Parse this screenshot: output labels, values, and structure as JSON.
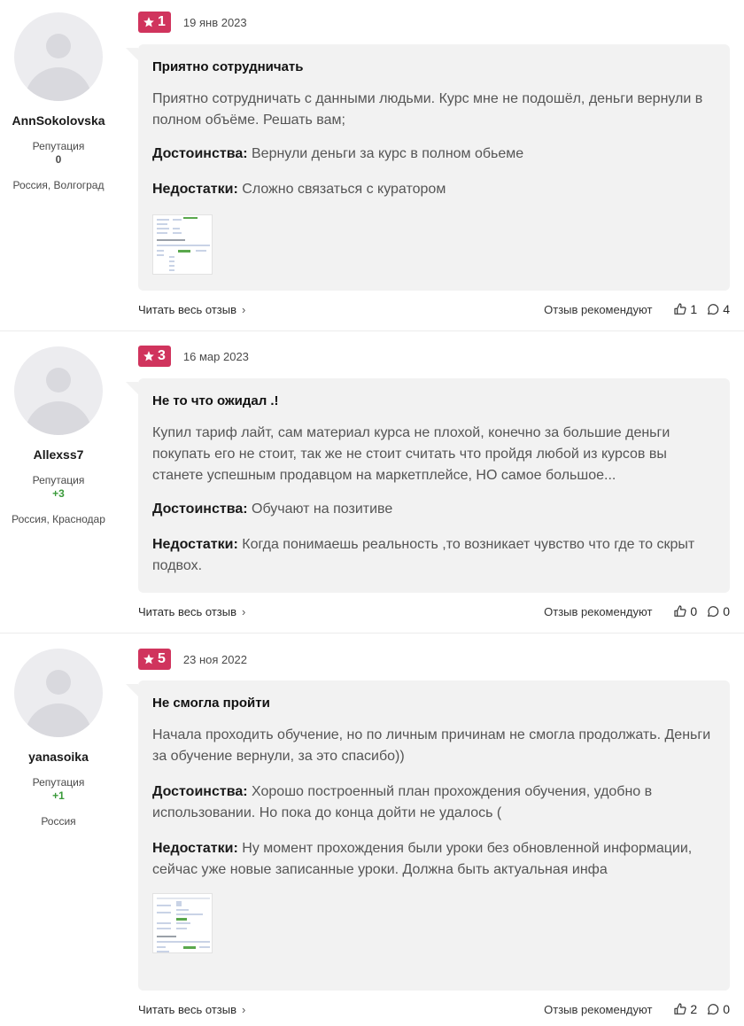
{
  "reviews": [
    {
      "rating": "1",
      "date": "19 янв 2023",
      "author": {
        "name": "AnnSokolovska",
        "reputation_label": "Репутация",
        "reputation": "0",
        "location": "Россия, Волгоград"
      },
      "title": "Приятно сотрудничать",
      "text": "Приятно сотрудничать с данными людьми. Курс мне не подошёл, деньги вернули в полном объёме. Решать вам;",
      "pros_label": "Достоинства:",
      "pros": "Вернули деньги за курс в полном обьеме",
      "cons_label": "Недостатки:",
      "cons": "Сложно связаться с куратором",
      "read_more": "Читать весь отзыв",
      "recommend_label": "Отзыв рекомендуют",
      "likes": "1",
      "comments": "4"
    },
    {
      "rating": "3",
      "date": "16 мар 2023",
      "author": {
        "name": "Allexss7",
        "reputation_label": "Репутация",
        "reputation": "+3",
        "location": "Россия, Краснодар"
      },
      "title": "Не то что ожидал .!",
      "text": "Купил тариф лайт, сам материал курса не плохой, конечно за большие деньги покупать его не стоит, так же не стоит считать что пройдя любой из курсов вы станете успешным продавцом на маркетплейсе, НО самое большое...",
      "pros_label": "Достоинства:",
      "pros": "Обучают на позитиве",
      "cons_label": "Недостатки:",
      "cons": "Когда понимаешь реальность ,то возникает чувство что где то скрыт подвох.",
      "read_more": "Читать весь отзыв",
      "recommend_label": "Отзыв рекомендуют",
      "likes": "0",
      "comments": "0"
    },
    {
      "rating": "5",
      "date": "23 ноя 2022",
      "author": {
        "name": "yanasoika",
        "reputation_label": "Репутация",
        "reputation": "+1",
        "location": "Россия"
      },
      "title": "Не смогла пройти",
      "text": "Начала проходить обучение, но по личным причинам не смогла продолжать. Деньги за обучение вернули, за это спасибо))",
      "pros_label": "Достоинства:",
      "pros": "Хорошо построенный план прохождения обучения, удобно в использовании. Но пока до конца дойти не удалось (",
      "cons_label": "Недостатки:",
      "cons": "Ну момент прохождения были уроки без обновленной информации, сейчас уже новые записанные уроки. Должна быть актуальная инфа",
      "read_more": "Читать весь отзыв",
      "recommend_label": "Отзыв рекомендуют",
      "likes": "2",
      "comments": "0"
    }
  ],
  "icons": {
    "rating": "star-icon",
    "like": "thumbs-up-icon",
    "comment": "comment-icon",
    "more": "chevron-right-icon"
  },
  "colors": {
    "badge": "#d0345d",
    "card_bg": "#f2f2f2",
    "reputation_positive": "#3a9a3a"
  }
}
